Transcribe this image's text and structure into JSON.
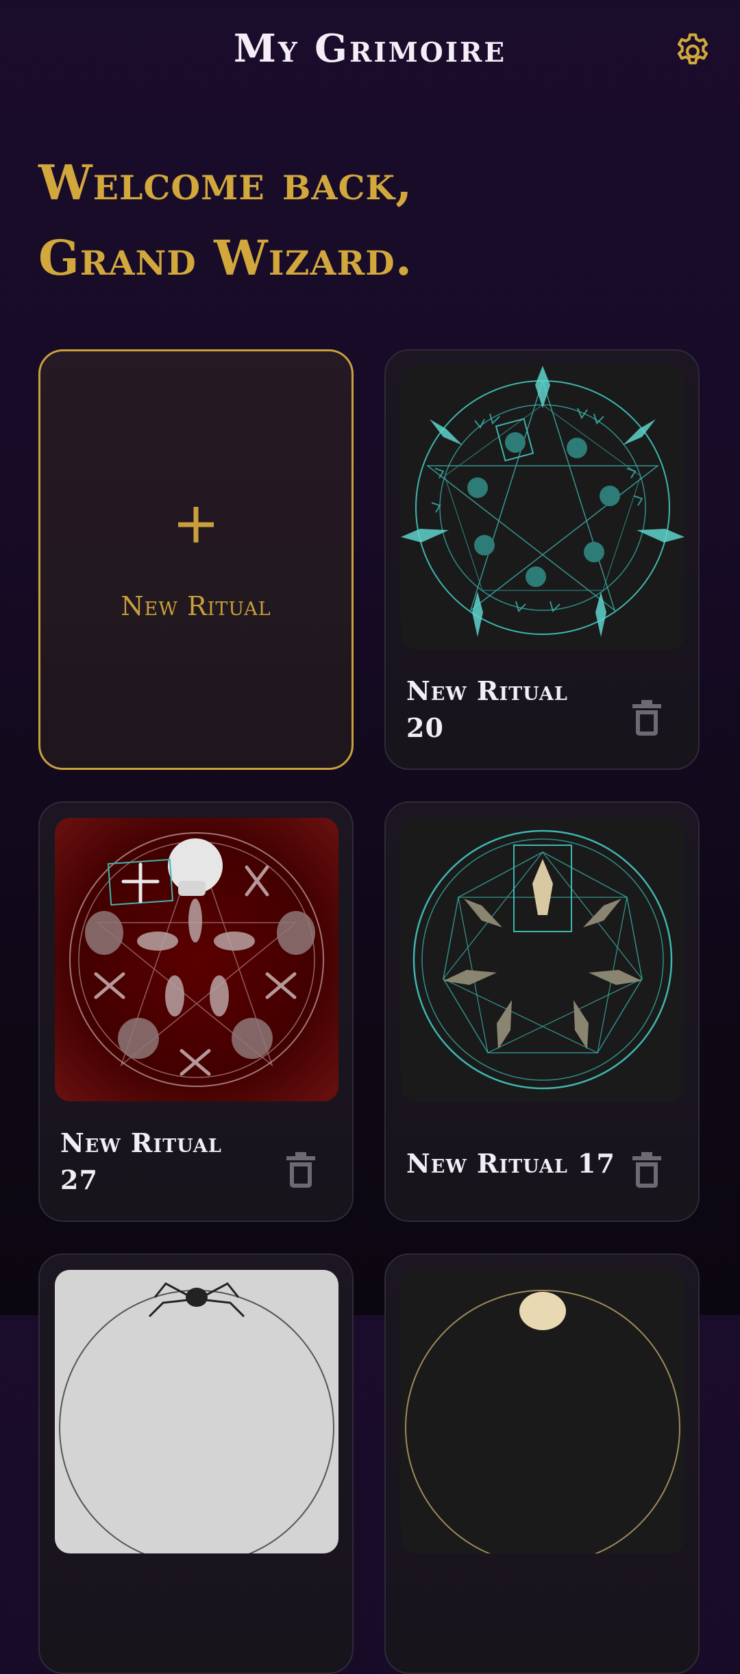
{
  "header": {
    "title": "My Grimoire",
    "settings_icon": "gear-icon"
  },
  "welcome": {
    "line1": "Welcome back,",
    "line2": "Grand Wizard."
  },
  "new_ritual_card": {
    "label": "New Ritual",
    "icon": "plus-icon"
  },
  "rituals": [
    {
      "name": "New Ritual 20",
      "thumbnail": "teal pentagram circle with crystals, skulls and runes",
      "delete_icon": "trash-icon"
    },
    {
      "name": "New Ritual 27",
      "thumbnail": "red pentagram circle with skulls, bones and skeletal hands",
      "delete_icon": "trash-icon"
    },
    {
      "name": "New Ritual 17",
      "thumbnail": "teal heptagram circle with crystals",
      "delete_icon": "trash-icon"
    }
  ],
  "colors": {
    "background": "#1a0c2b",
    "accent_gold": "#d2a83c",
    "card_border": "#2f2a3a",
    "teal": "#3fb6b0",
    "icon_gray": "#6e6a74"
  }
}
